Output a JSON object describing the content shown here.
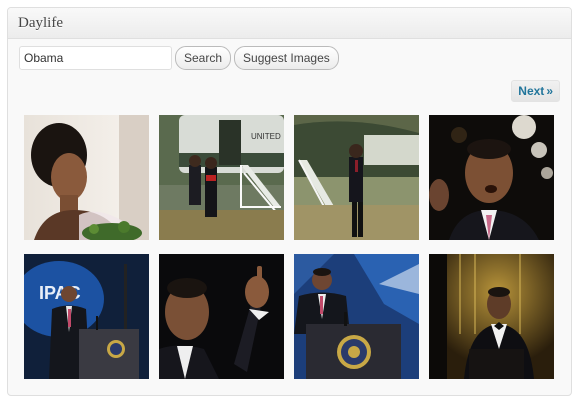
{
  "panel": {
    "title": "Daylife"
  },
  "search": {
    "query": "Obama",
    "search_label": "Search",
    "suggest_label": "Suggest Images"
  },
  "pager": {
    "next_label": "Next",
    "next_arrow": "»"
  },
  "images": [
    {
      "subject": "woman-portrait"
    },
    {
      "subject": "aircraft-stairs-salute"
    },
    {
      "subject": "walking-from-helicopter"
    },
    {
      "subject": "speaker-closeup-lights"
    },
    {
      "subject": "aipac-podium"
    },
    {
      "subject": "pointing-gesture"
    },
    {
      "subject": "presidential-seal-podium"
    },
    {
      "subject": "tuxedo-gold-background"
    }
  ]
}
